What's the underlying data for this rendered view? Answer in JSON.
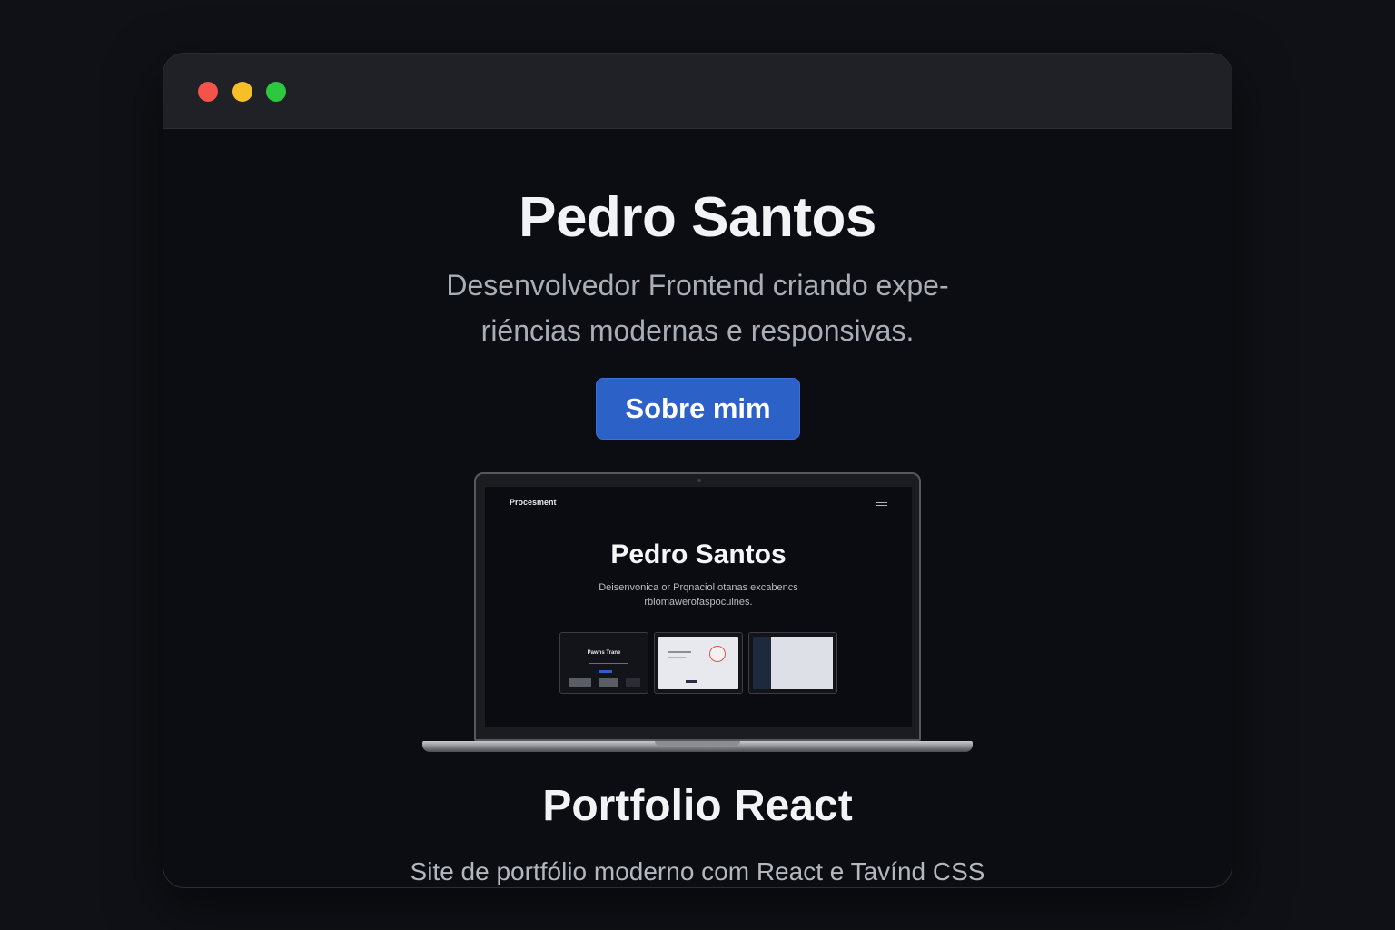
{
  "window": {
    "controls": [
      "close",
      "minimize",
      "maximize"
    ]
  },
  "hero": {
    "title": "Pedro Santos",
    "subtitle": "Desenvolvedor Frontend criando expe- riéncias modernas e responsivas.",
    "button_label": "Sobre mim"
  },
  "project": {
    "preview": {
      "nav_label": "Procesment",
      "title": "Pedro Santos",
      "subtitle": "Deisenvonica or Prqnaciol otanas excabencs rbiomawerofaspocuines.",
      "thumbnail_label": "Pawns Trane"
    },
    "title": "Portfolio React",
    "description": "Site de portfólio moderno com React e Tavínd CSS"
  },
  "colors": {
    "background": "#0f1116",
    "window_bg": "#0b0d12",
    "titlebar": "#1f2126",
    "accent": "#2c62c8",
    "close": "#f3534b",
    "minimize": "#f5bf2a",
    "maximize": "#2cc840"
  }
}
